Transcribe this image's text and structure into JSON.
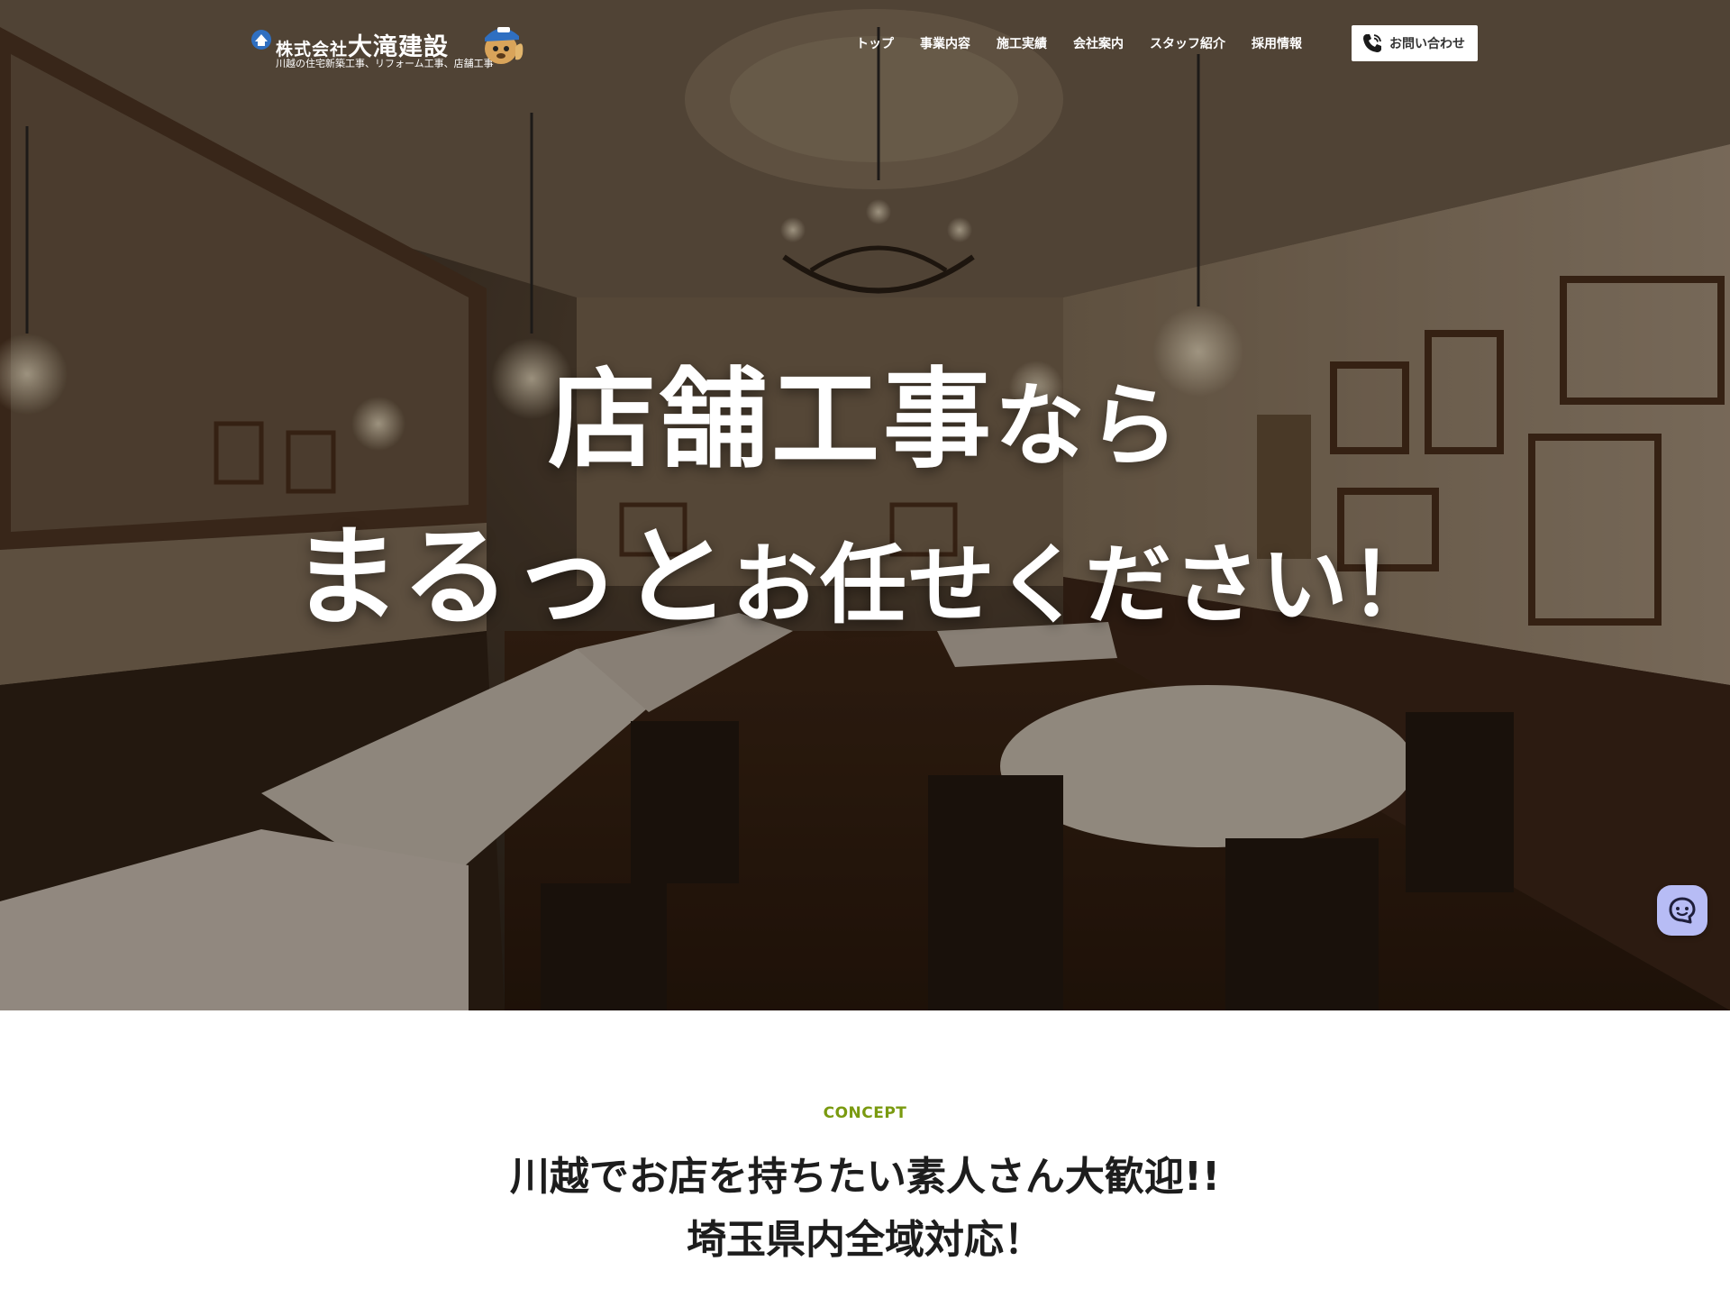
{
  "header": {
    "logo": {
      "company_prefix": "株式会社",
      "company_name": "大滝建設",
      "tagline": "川越の住宅新築工事、リフォーム工事、店舗工事"
    },
    "nav": [
      {
        "label": "トップ"
      },
      {
        "label": "事業内容"
      },
      {
        "label": "施工実績"
      },
      {
        "label": "会社案内"
      },
      {
        "label": "スタッフ紹介"
      },
      {
        "label": "採用情報"
      }
    ],
    "contact_button": {
      "label": "お問い合わせ",
      "icon": "phone-icon"
    }
  },
  "hero": {
    "headline_line1_main": "店舗工事",
    "headline_line1_small": "なら",
    "headline_line2_main": "まるっと",
    "headline_line2_small": "お任せください！",
    "background": "restaurant-interior-photo"
  },
  "chat_button": {
    "icon": "chat-icon",
    "color": "#b7bcf5"
  },
  "concept": {
    "label": "CONCEPT",
    "title_line1": "川越でお店を持ちたい素人さん大歓迎!!",
    "title_line2": "埼玉県内全域対応！"
  },
  "colors": {
    "accent_green": "#7a9a10",
    "logo_blue": "#2f6fc1",
    "chat_bubble": "#b7bcf5"
  }
}
